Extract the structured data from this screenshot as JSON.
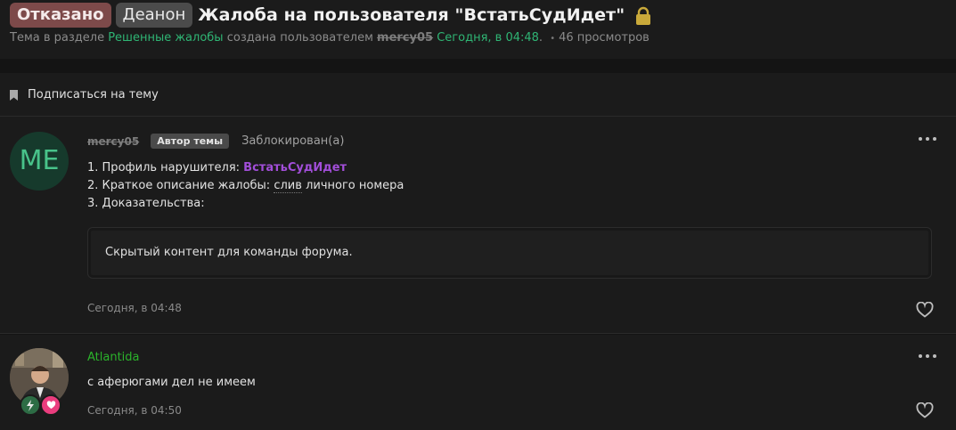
{
  "thread": {
    "prefix_status": "Отказано",
    "prefix_category": "Деанон",
    "title": "Жалоба на пользователя \"ВстатьСудИдет\"",
    "meta_prefix": "Тема в разделе",
    "section": "Решенные жалобы",
    "created_by": "создана пользователем",
    "author": "mercy05",
    "created_at": "Сегодня, в 04:48",
    "views": "46 просмотров"
  },
  "subscribe": {
    "label": "Подписаться на тему"
  },
  "posts": [
    {
      "avatar_initials": "ME",
      "username": "mercy05",
      "author_tag": "Автор темы",
      "status": "Заблокирован(а)",
      "line1_prefix": "1. Профиль нарушителя:",
      "line1_link": "ВстатьСудИдет",
      "line2_prefix": "2. Краткое описание жалобы:",
      "line2_mark": "слив",
      "line2_rest": "личного номера",
      "line3": "3. Доказательства:",
      "hidden_content": "Скрытый контент для команды форума.",
      "time": "Сегодня, в 04:48"
    },
    {
      "username": "Atlantida",
      "text": "с аферюгами дел не имеем",
      "time": "Сегодня, в 04:50"
    }
  ],
  "colors": {
    "accent_green": "#2fb574",
    "status_red": "#7d4a4a",
    "link_purple": "#a24ed9",
    "username_green": "#2bb32b"
  },
  "icons": [
    "lock-icon",
    "bookmark-icon",
    "more-icon",
    "heart-icon",
    "lightning-icon",
    "heart-badge-icon"
  ]
}
